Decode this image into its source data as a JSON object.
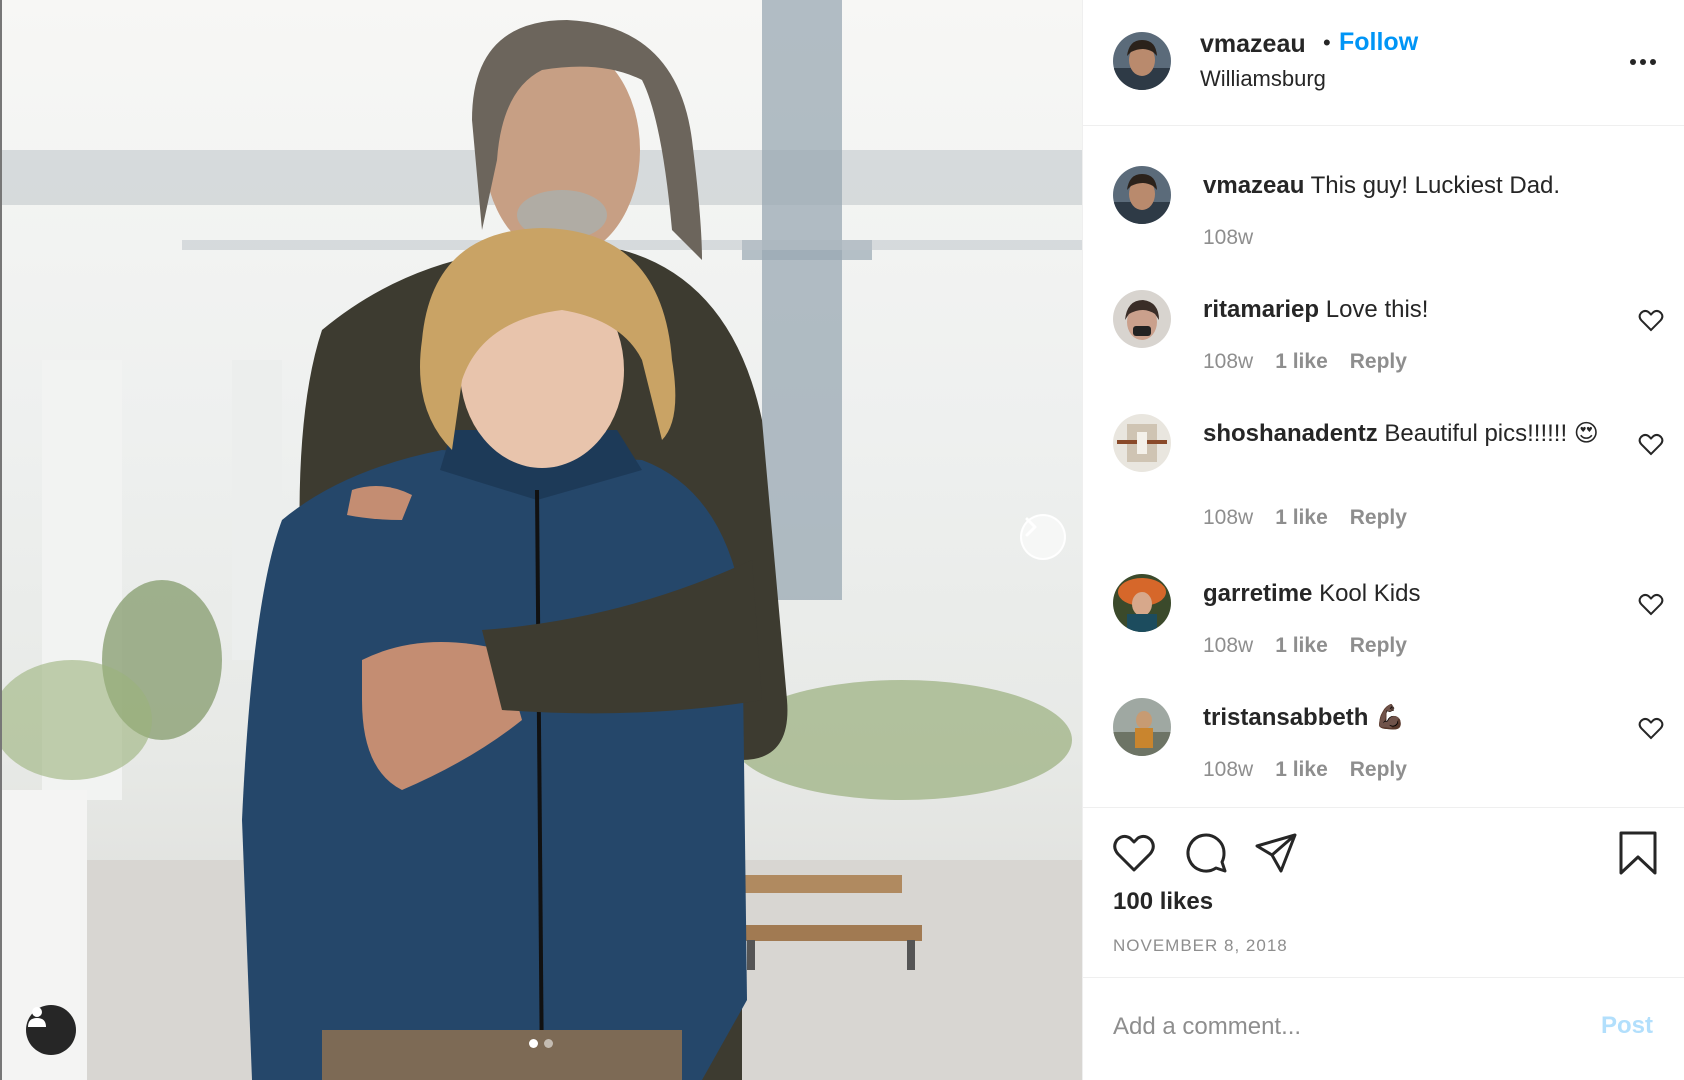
{
  "post": {
    "username": "vmazeau",
    "separator": "•",
    "follow_label": "Follow",
    "location": "Williamsburg",
    "photo_index": 1,
    "photo_count": 2
  },
  "comments": [
    {
      "username": "vmazeau",
      "text": "This guy! Luckiest Dad.",
      "time": "108w",
      "likes": "",
      "reply": ""
    },
    {
      "username": "ritamariep",
      "text": "Love this!",
      "time": "108w",
      "likes": "1 like",
      "reply": "Reply"
    },
    {
      "username": "shoshanadentz",
      "text": "Beautiful pics!!!!!! 😍",
      "time": "108w",
      "likes": "1 like",
      "reply": "Reply"
    },
    {
      "username": "garretime",
      "text": "Kool Kids",
      "time": "108w",
      "likes": "1 like",
      "reply": "Reply"
    },
    {
      "username": "tristansabbeth",
      "text": "💪🏿",
      "time": "108w",
      "likes": "1 like",
      "reply": "Reply"
    }
  ],
  "actions": {
    "likes": "100 likes",
    "date": "NOVEMBER 8, 2018"
  },
  "add_comment": {
    "placeholder": "Add a comment...",
    "post_label": "Post"
  },
  "colors": {
    "accent": "#0095f6",
    "post_disabled": "#b2dffc",
    "muted": "#8e8e8e"
  },
  "icons": [
    "chevron-right-icon",
    "user-icon",
    "more-icon",
    "heart-icon",
    "comment-icon",
    "share-icon",
    "bookmark-icon"
  ]
}
